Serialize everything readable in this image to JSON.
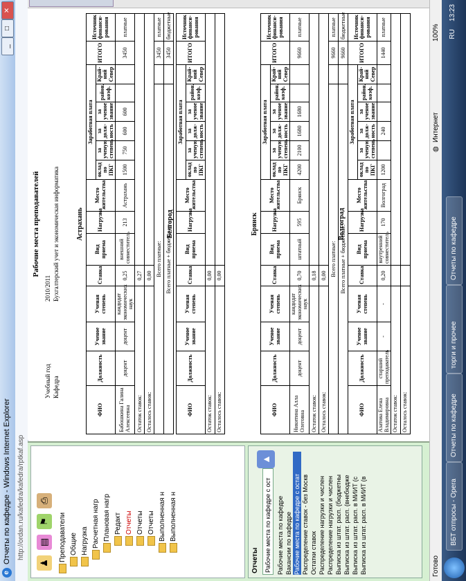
{
  "window": {
    "title": "Отчеты по кафедре - Windows Internet Explorer",
    "url": "http://ordan.ru/kafedra/kafedra/rptkaf.asp"
  },
  "tree": {
    "nodes": [
      "Преподаватели",
      "Общие",
      "Нагрузка",
      "Расчетная нагр",
      "Плановая нагр",
      "Редакт",
      "Отчеты",
      "Отчеты",
      "Отчеты",
      "Выполненная н",
      "Выполненная н"
    ]
  },
  "reports": {
    "header": "Отчеты",
    "selected": "Рабочие места по кафедре с ост",
    "items": [
      "Рабочие места по кафедре",
      "Вакансии по кафедре",
      "Рабочие места по кафедре с остат",
      "Распределение ставок - без Москв",
      "Остатки ставок",
      "Распределение нагрузки и числен",
      "Распределение нагрузки и числен",
      "Выписка из штат. расп. (бюджетны",
      "Выписка из штат. расп. (внебюдже",
      "Выписка из штат. расп. в МИИТ (с",
      "Выписка из штат. расп. в МИИТ (в"
    ],
    "zoom_small": "86%"
  },
  "doc": {
    "title": "Рабочие места преподавателей",
    "year_label": "Учебный год",
    "year_value": "2010/2011",
    "dept_label": "Кафедра",
    "dept_value": "Бухгалтерский учет и экономическая информатика",
    "headers": {
      "fio": "ФИО",
      "position": "Должность",
      "rank": "Ученое звание",
      "degree": "Ученая степень",
      "rate": "Ставка",
      "hire": "Вид приема",
      "load": "Нагрузка",
      "residence": "Место жительства",
      "salary": "Заработная плата",
      "pkg": "оклад по ПКГ",
      "sal_degree": "за ученую степень",
      "sal_pos": "за долж-ность",
      "sal_rank": "за ученое звание",
      "district": "район. коэф.",
      "north": "Край-ний Север",
      "total": "ИТОГО",
      "source": "Источник финанси-рования"
    },
    "summary_labels": {
      "used": "Остаток ставок:",
      "left": "Осталось ставок:",
      "paid": "Всего платные:",
      "all": "Всего платные + бюджетные:",
      "paid_src": "платные",
      "budget_src": "бюджетные"
    },
    "sections": [
      {
        "city": "Астрахань",
        "rows": [
          {
            "fio": "Бабошкина Галина Алексеевна",
            "position": "доцент",
            "rank": "доцент",
            "degree": "кандидат экономических наук",
            "rate": "0,25",
            "hire": "внешний совместитель",
            "load": "213",
            "residence": "Астрахань",
            "pkg": "1500",
            "sal_degree": "750",
            "sal_pos": "600",
            "sal_rank": "600",
            "district": "",
            "north": "",
            "total": "3450",
            "source": "платные"
          }
        ],
        "used": "0,27",
        "left": "0,00",
        "paid": "3450",
        "all": "3450"
      },
      {
        "city": "Белгород",
        "rows": [],
        "used": "0,00",
        "left": "0,00",
        "paid": "",
        "all": ""
      },
      {
        "city": "Брянск",
        "rows": [
          {
            "fio": "Никитина Алла Олеговна",
            "position": "доцент",
            "rank": "доцент",
            "degree": "кандидат экономических наук",
            "rate": "0,70",
            "hire": "штатный",
            "load": "595",
            "residence": "Брянск",
            "pkg": "4200",
            "sal_degree": "2100",
            "sal_pos": "1680",
            "sal_rank": "1680",
            "district": "",
            "north": "",
            "total": "9660",
            "source": "платные"
          }
        ],
        "used": "0,18",
        "left": "0,00",
        "paid": "9660",
        "all": "9660"
      },
      {
        "city": "Волгоград",
        "rows": [
          {
            "fio": "Азатова Елена Владимировна",
            "position": "старший преподаватель",
            "rank": "-",
            "degree": "-",
            "rate": "0,20",
            "hire": "внутренний совместитель",
            "load": "170",
            "residence": "Волгоград",
            "pkg": "1200",
            "sal_degree": "",
            "sal_pos": "240",
            "sal_rank": "",
            "district": "",
            "north": "",
            "total": "1440",
            "source": "платные"
          }
        ],
        "used": "",
        "left": "",
        "paid": "",
        "all": ""
      }
    ]
  },
  "status": {
    "left": "Готово",
    "zone": "Интернет",
    "zoom": "100%"
  },
  "taskbar": {
    "tasks": [
      "ВБТ отпросы - Opera",
      "Отчеты по кафедре",
      "торги и прочее",
      "Отчеты по кафедре"
    ],
    "lang": "RU",
    "time": "13:23"
  }
}
